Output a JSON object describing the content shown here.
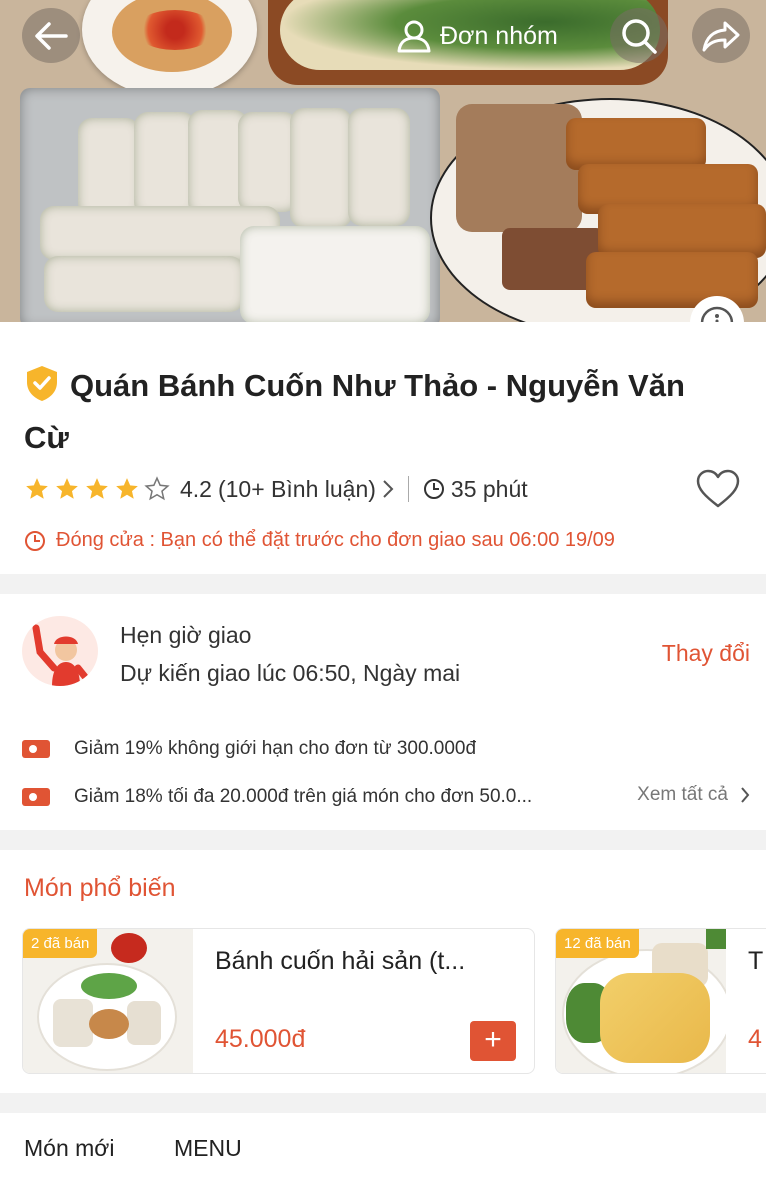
{
  "header": {
    "group_order_label": "Đơn nhóm",
    "icons": [
      "back-arrow-icon",
      "group-user-icon",
      "search-icon",
      "share-icon",
      "info-icon"
    ]
  },
  "shop": {
    "name": "Quán Bánh Cuốn Như Thảo - Nguyễn Văn Cừ",
    "rating": "4.2",
    "reviews": "(10+ Bình luận)",
    "stars_filled": 4,
    "stars_total": 5,
    "prep_time": "35 phút",
    "closed_notice": "Đóng cửa : Bạn có thể đặt trước cho đơn giao sau 06:00 19/09"
  },
  "delivery": {
    "title": "Hẹn giờ giao",
    "eta": "Dự kiến giao lúc 06:50, Ngày mai",
    "change_label": "Thay đổi",
    "promos": [
      "Giảm 19% không giới hạn cho đơn từ 300.000đ",
      "Giảm 18% tối đa 20.000đ trên giá món cho đơn 50.0..."
    ],
    "see_all": "Xem tất cả"
  },
  "popular": {
    "title": "Món phổ biến",
    "items": [
      {
        "sold": "2 đã bán",
        "name": "Bánh cuốn hải sản (t...",
        "price": "45.000đ",
        "add": "+"
      },
      {
        "sold": "12 đã bán",
        "name": "T",
        "price": "4"
      }
    ]
  },
  "tabs": [
    "Món mới",
    "MENU"
  ],
  "colors": {
    "accent": "#e05434",
    "star": "#f7b52b",
    "sold_badge": "#f7b52b",
    "verified": "#f7b52b"
  }
}
